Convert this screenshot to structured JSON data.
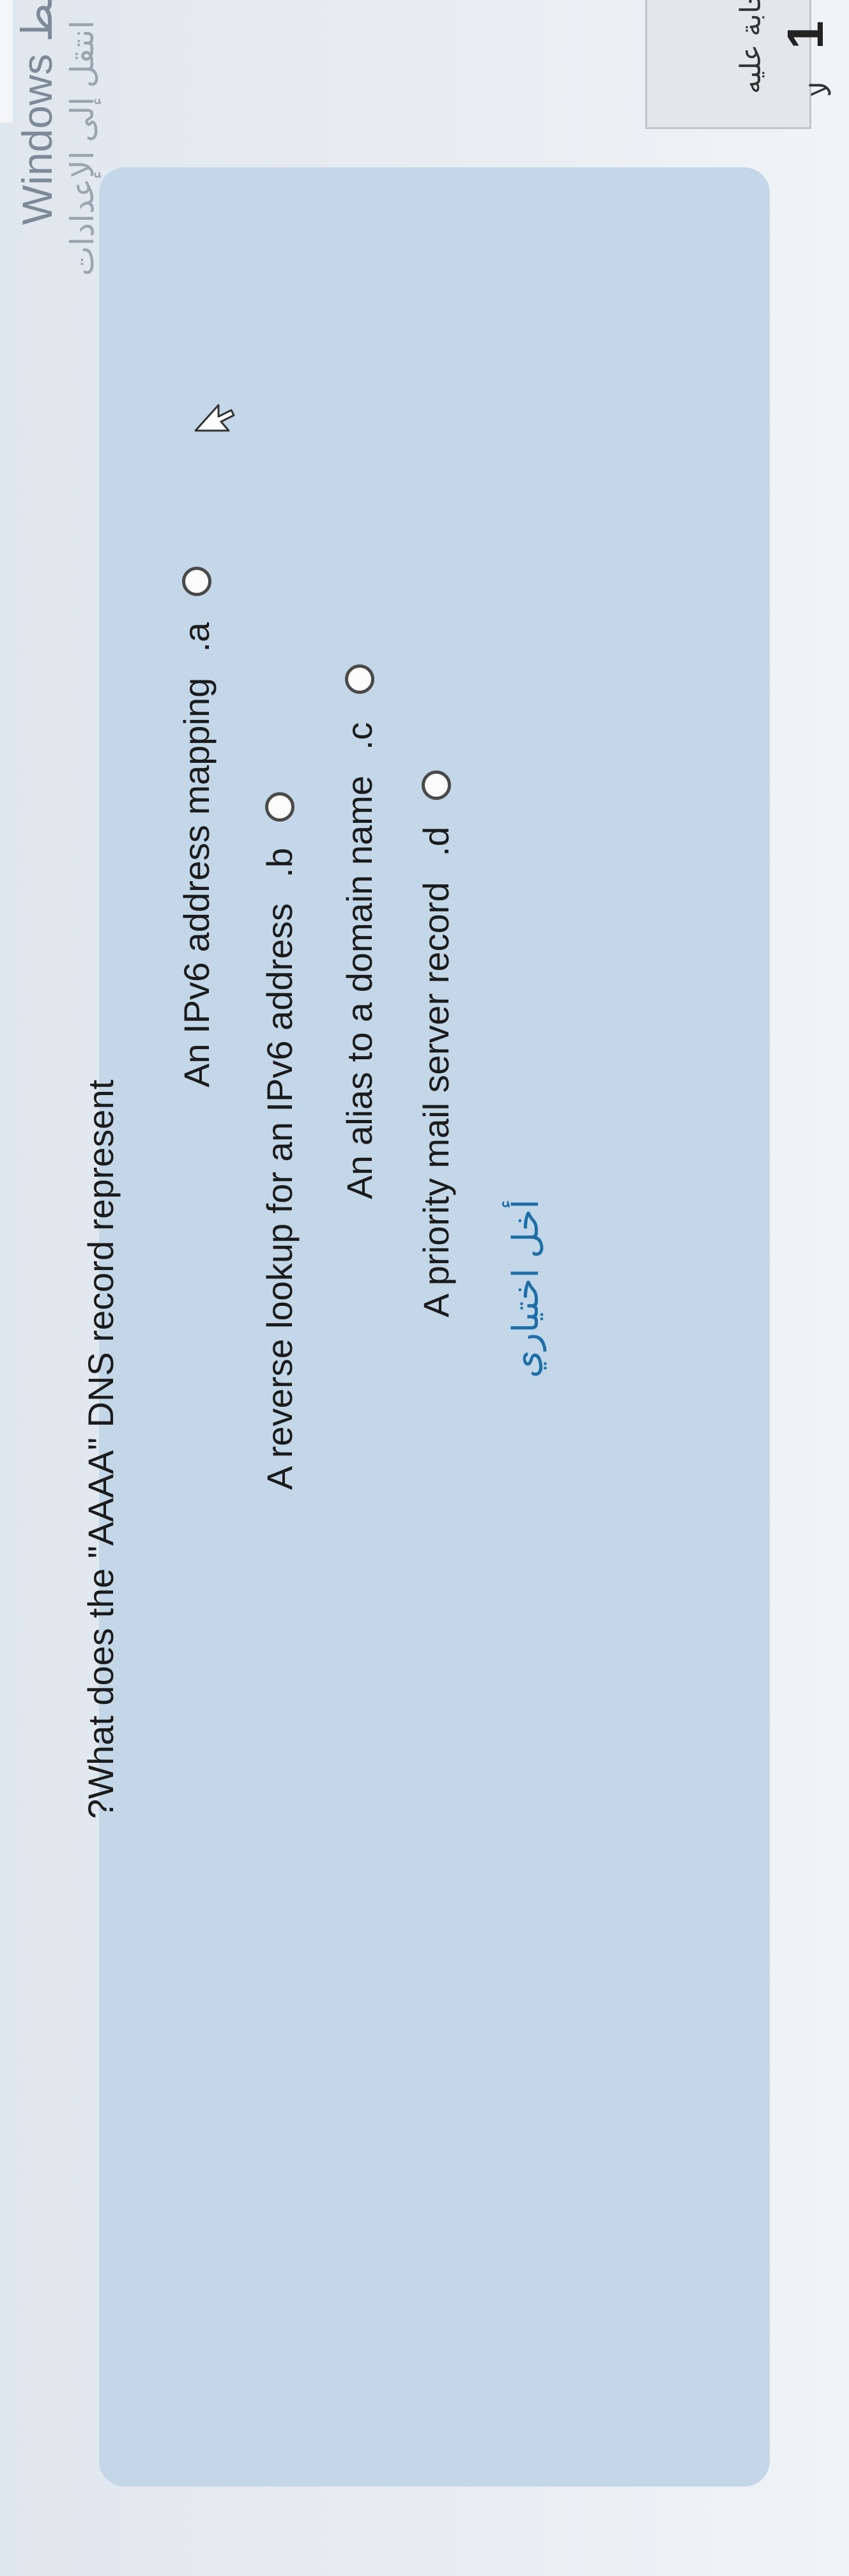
{
  "question": {
    "text": "?What does the \"AAAA\" DNS record represent",
    "options": [
      {
        "text": "An IPv6 address mapping",
        "letter": ".a",
        "selected": false
      },
      {
        "text": "A reverse lookup for an IPv6 address",
        "letter": ".b",
        "selected": false
      },
      {
        "text": "An alias to a domain name",
        "letter": ".c",
        "selected": false
      },
      {
        "text": "A priority mail server record",
        "letter": ".d",
        "selected": false
      }
    ],
    "clear_choice": "أخل اختياري"
  },
  "question_info": {
    "number": "1",
    "status": "لم تتم الإجابة عليه",
    "flag": "لا"
  },
  "windows_watermark": {
    "line1": "تنشيط Windows",
    "line2": "انتقل إلى الإعدادات"
  },
  "colors": {
    "panel": "#c3d7e8",
    "link": "#1d6fa8"
  }
}
